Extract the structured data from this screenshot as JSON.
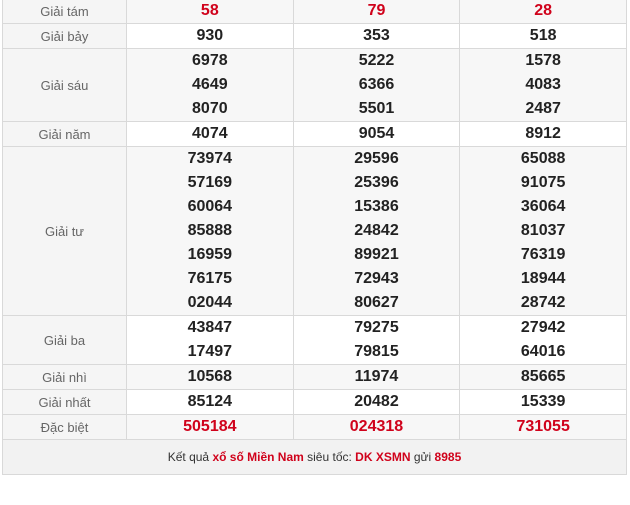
{
  "rows": [
    {
      "label": "Giải tám",
      "values": [
        [
          "58"
        ],
        [
          "79"
        ],
        [
          "28"
        ]
      ],
      "red": true
    },
    {
      "label": "Giải bảy",
      "values": [
        [
          "930"
        ],
        [
          "353"
        ],
        [
          "518"
        ]
      ]
    },
    {
      "label": "Giải sáu",
      "values": [
        [
          "6978",
          "4649",
          "8070"
        ],
        [
          "5222",
          "6366",
          "5501"
        ],
        [
          "1578",
          "4083",
          "2487"
        ]
      ]
    },
    {
      "label": "Giải năm",
      "values": [
        [
          "4074"
        ],
        [
          "9054"
        ],
        [
          "8912"
        ]
      ]
    },
    {
      "label": "Giải tư",
      "values": [
        [
          "73974",
          "57169",
          "60064",
          "85888",
          "16959",
          "76175",
          "02044"
        ],
        [
          "29596",
          "25396",
          "15386",
          "24842",
          "89921",
          "72943",
          "80627"
        ],
        [
          "65088",
          "91075",
          "36064",
          "81037",
          "76319",
          "18944",
          "28742"
        ]
      ]
    },
    {
      "label": "Giải ba",
      "values": [
        [
          "43847",
          "17497"
        ],
        [
          "79275",
          "79815"
        ],
        [
          "27942",
          "64016"
        ]
      ]
    },
    {
      "label": "Giải nhì",
      "values": [
        [
          "10568"
        ],
        [
          "11974"
        ],
        [
          "85665"
        ]
      ]
    },
    {
      "label": "Giải nhất",
      "values": [
        [
          "85124"
        ],
        [
          "20482"
        ],
        [
          "15339"
        ]
      ]
    },
    {
      "label": "Đặc biệt",
      "values": [
        [
          "505184"
        ],
        [
          "024318"
        ],
        [
          "731055"
        ]
      ],
      "red": true
    }
  ],
  "footer": {
    "prefix": "Kết quả ",
    "link_text": "xổ số Miền Nam",
    "middle": " siêu tốc: ",
    "sms_code": "DK XSMN",
    "send_word": " gửi ",
    "number": "8985"
  },
  "colors": {
    "accent": "#d0021b",
    "label_bg": "#f5f5f5",
    "border": "#d9d9d9"
  }
}
